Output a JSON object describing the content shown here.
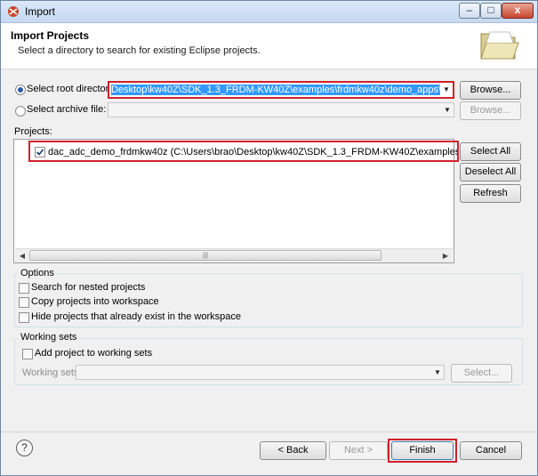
{
  "window": {
    "title": "Import",
    "minimize_label": "–",
    "maximize_label": "□",
    "close_label": "x"
  },
  "header": {
    "title": "Import Projects",
    "subtitle": "Select a directory to search for existing Eclipse projects."
  },
  "source": {
    "root_label": "Select root directory:",
    "root_value": "Desktop\\kw40Z\\SDK_1.3_FRDM-KW40Z\\examples\\frdmkw40z\\demo_apps\\dac_adc_demo",
    "root_selected": true,
    "archive_label": "Select archive file:",
    "archive_value": "",
    "archive_selected": false,
    "browse_label": "Browse...",
    "archive_browse_label": "Browse..."
  },
  "projects": {
    "label": "Projects:",
    "items": [
      {
        "checked": true,
        "text": "dac_adc_demo_frdmkw40z (C:\\Users\\brao\\Desktop\\kw40Z\\SDK_1.3_FRDM-KW40Z\\examples\\frdmkw40z\\demo_"
      }
    ],
    "select_all_label": "Select All",
    "deselect_all_label": "Deselect All",
    "refresh_label": "Refresh"
  },
  "options": {
    "legend": "Options",
    "items": [
      {
        "label": "Search for nested projects",
        "checked": false
      },
      {
        "label": "Copy projects into workspace",
        "checked": false
      },
      {
        "label": "Hide projects that already exist in the workspace",
        "checked": false
      }
    ]
  },
  "working_sets": {
    "legend": "Working sets",
    "add_label": "Add project to working sets",
    "add_checked": false,
    "sets_label": "Working sets:",
    "sets_value": "",
    "select_label": "Select..."
  },
  "footer": {
    "help_label": "?",
    "back_label": "< Back",
    "next_label": "Next >",
    "finish_label": "Finish",
    "cancel_label": "Cancel"
  },
  "colors": {
    "highlight": "#d0202a",
    "selection": "#3399ff"
  }
}
